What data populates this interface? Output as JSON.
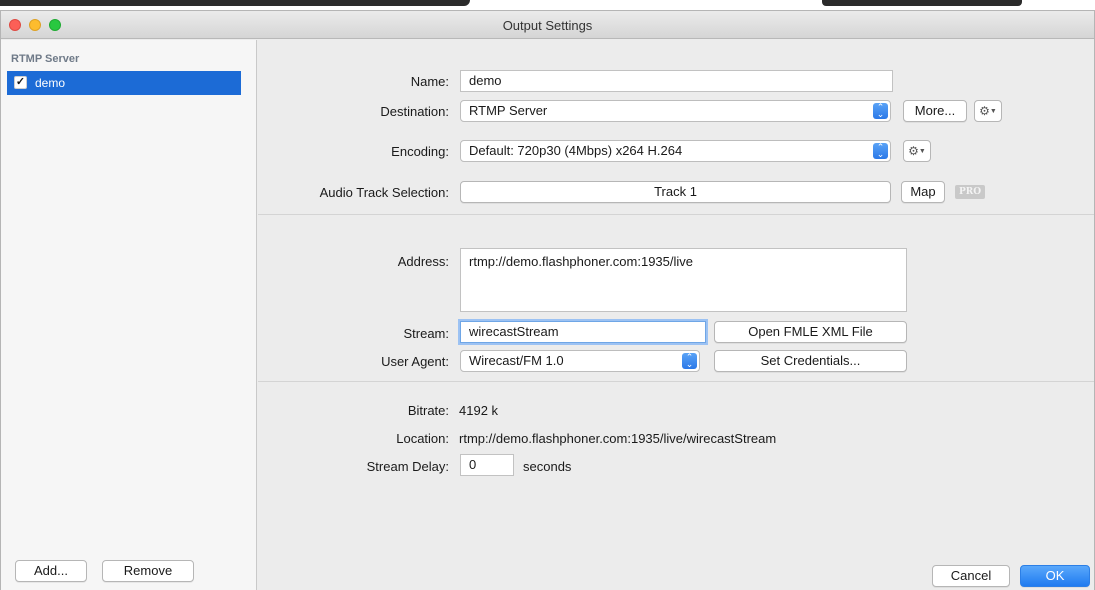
{
  "window": {
    "title": "Output Settings"
  },
  "sidebar": {
    "header": "RTMP Server",
    "items": [
      {
        "label": "demo",
        "checked": true,
        "selected": true
      }
    ],
    "add_label": "Add...",
    "remove_label": "Remove"
  },
  "output": {
    "name_label": "Name:",
    "name_value": "demo",
    "destination_label": "Destination:",
    "destination_value": "RTMP Server",
    "more_label": "More...",
    "encoding_label": "Encoding:",
    "encoding_value": "Default: 720p30 (4Mbps) x264 H.264",
    "audio_label": "Audio Track Selection:",
    "audio_value": "Track 1",
    "map_label": "Map",
    "pro_badge": "PRO"
  },
  "server": {
    "address_label": "Address:",
    "address_value": "rtmp://demo.flashphoner.com:1935/live",
    "stream_label": "Stream:",
    "stream_value": "wirecastStream",
    "open_fmle_label": "Open FMLE XML File",
    "user_agent_label": "User Agent:",
    "user_agent_value": "Wirecast/FM 1.0",
    "set_credentials_label": "Set Credentials..."
  },
  "info": {
    "bitrate_label": "Bitrate:",
    "bitrate_value": "4192 k",
    "location_label": "Location:",
    "location_value": "rtmp://demo.flashphoner.com:1935/live/wirecastStream",
    "delay_label": "Stream Delay:",
    "delay_value": "0",
    "delay_unit": "seconds"
  },
  "footer": {
    "cancel_label": "Cancel",
    "ok_label": "OK"
  },
  "icons": {
    "checkmark": "checkmark-icon",
    "gear": "gear-icon",
    "popup_stepper": "chevron-up-down-icon"
  },
  "colors": {
    "accent": "#1c6bd6",
    "ok_button": "#1f7bf0",
    "close": "#fc5f57",
    "minimize": "#fdbc2e",
    "maximize": "#28c840"
  }
}
